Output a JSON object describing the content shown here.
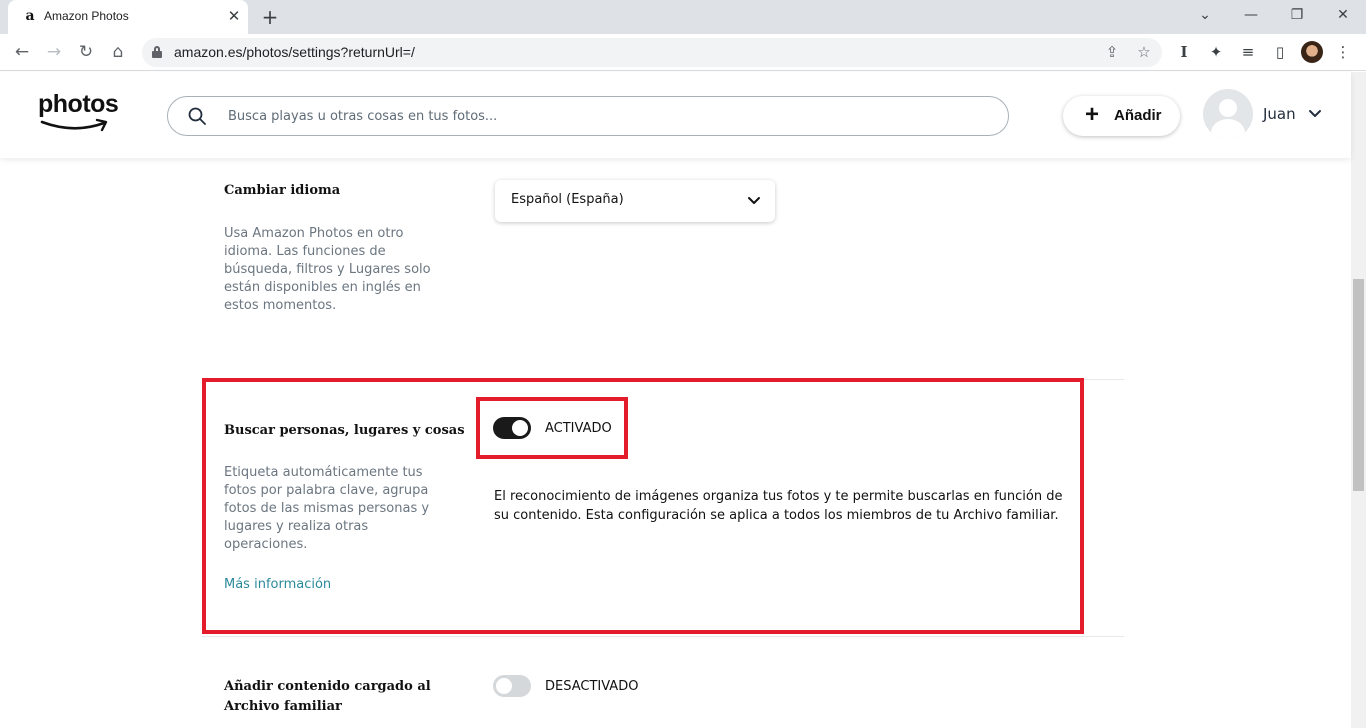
{
  "browser": {
    "tab_favicon": "a",
    "tab_title": "Amazon Photos",
    "tab_close": "✕",
    "new_tab": "+",
    "url": "amazon.es/photos/settings?returnUrl=/",
    "window_controls": {
      "minimize": "⌄",
      "restore": "—",
      "maximize": "❐",
      "close": "✕"
    }
  },
  "header": {
    "logo_text": "photos",
    "search_placeholder": "Busca playas u otras cosas en tus fotos...",
    "add_icon": "+",
    "add_label": "Añadir",
    "user_name": "Juan"
  },
  "settings": {
    "language": {
      "title": "Cambiar idioma",
      "description": "Usa Amazon Photos en otro idioma. Las funciones de búsqueda, filtros y Lugares solo están disponibles en inglés en estos momentos.",
      "selected": "Español (España)"
    },
    "search_people": {
      "title": "Buscar personas, lugares y cosas",
      "toggle_state": "on",
      "toggle_label": "ACTIVADO",
      "description": "Etiqueta automáticamente tus fotos por palabra clave, agrupa fotos de las mismas personas y lugares y realiza otras operaciones.",
      "info": "El reconocimiento de imágenes organiza tus fotos y te permite buscarlas en función de su contenido. Esta configuración se aplica a todos los miembros de tu Archivo familiar.",
      "more_link": "Más información"
    },
    "family_vault": {
      "title": "Añadir contenido cargado al Archivo familiar",
      "toggle_state": "off",
      "toggle_label": "DESACTIVADO"
    }
  },
  "colors": {
    "highlight": "#e31b2a",
    "link": "#2a8a9a",
    "toggle_on": "#1a1a1a",
    "toggle_off": "#d5d8da"
  }
}
